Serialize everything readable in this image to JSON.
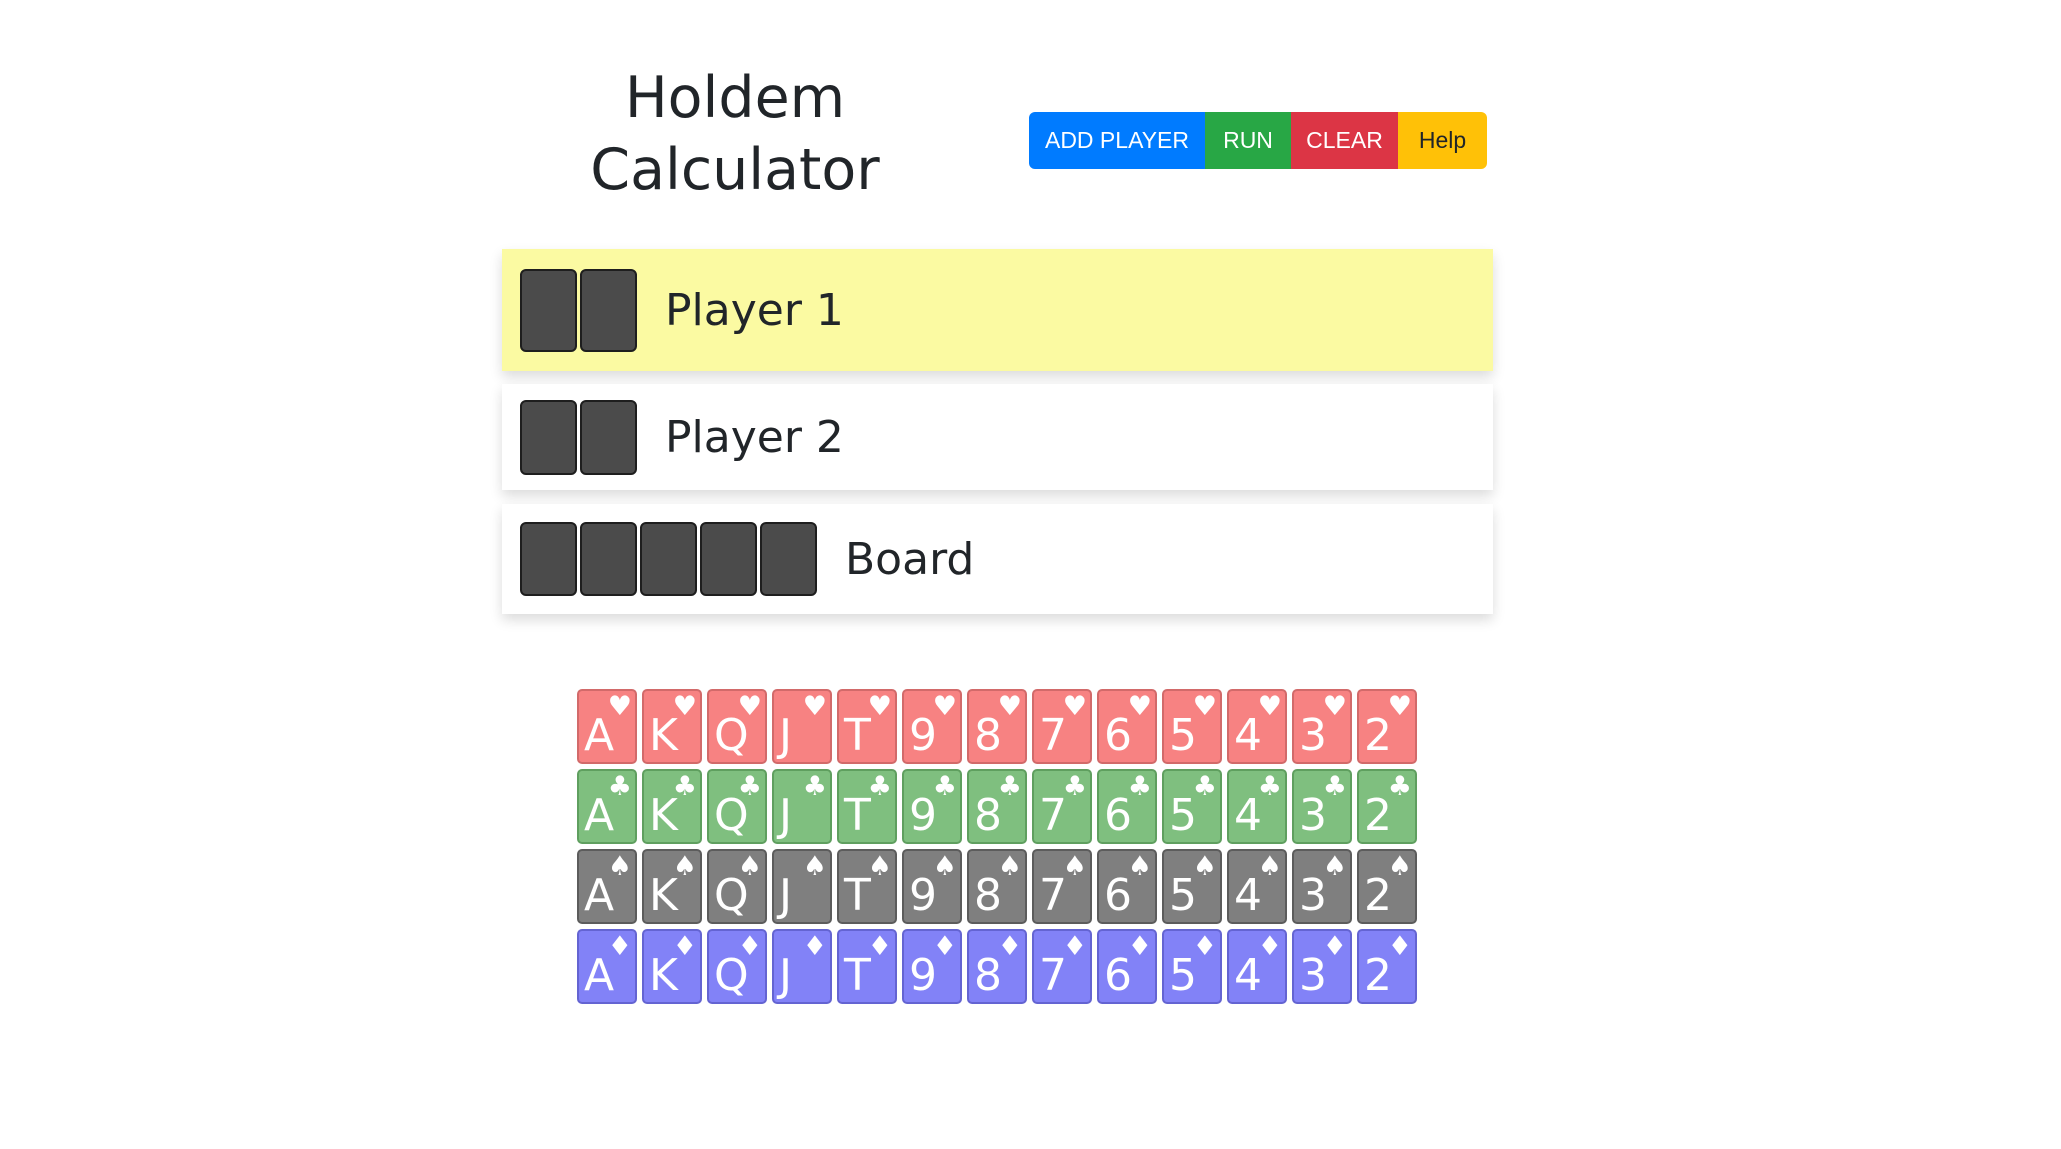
{
  "title": "Holdem Calculator",
  "buttons": {
    "add_player": "ADD PLAYER",
    "run": "RUN",
    "clear": "CLEAR",
    "help": "Help"
  },
  "colors": {
    "add_player": "#007bff",
    "run": "#28a745",
    "clear": "#dc3545",
    "help": "#ffc107",
    "active_row": "#fbfaa2",
    "empty_slot": "#4b4b4b"
  },
  "players": [
    {
      "label": "Player 1",
      "active": true,
      "slots": 2
    },
    {
      "label": "Player 2",
      "active": false,
      "slots": 2
    }
  ],
  "board": {
    "label": "Board",
    "slots": 5
  },
  "deck": {
    "ranks": [
      "A",
      "K",
      "Q",
      "J",
      "T",
      "9",
      "8",
      "7",
      "6",
      "5",
      "4",
      "3",
      "2"
    ],
    "suits": [
      {
        "name": "hearts",
        "symbol": "♥",
        "bg": "#f78282",
        "border": "#d26a6a"
      },
      {
        "name": "clubs",
        "symbol": "♣",
        "bg": "#7fbf7f",
        "border": "#5f9f5f"
      },
      {
        "name": "spades",
        "symbol": "♠",
        "bg": "#7f7f7f",
        "border": "#5c5c5c"
      },
      {
        "name": "diamonds",
        "symbol": "♦",
        "bg": "#8282f7",
        "border": "#6464d2"
      }
    ]
  }
}
